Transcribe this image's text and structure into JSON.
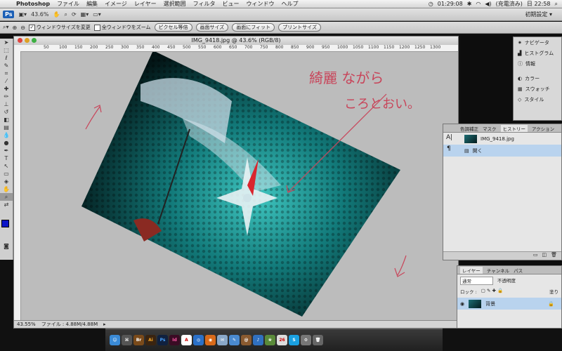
{
  "menubar": {
    "app_name": "Photoshop",
    "items": [
      "ファイル",
      "編集",
      "イメージ",
      "レイヤー",
      "選択範囲",
      "フィルタ",
      "ビュー",
      "ウィンドウ",
      "ヘルプ"
    ],
    "clock": "01:29:08",
    "battery": "(充電済み)",
    "date_time": "日 22:58"
  },
  "appbar": {
    "zoom": "43.6%",
    "workspace": "初期設定 ▾"
  },
  "options": {
    "resize_window": "ウィンドウサイズを変更",
    "zoom_all": "全ウィンドウをズーム",
    "buttons": [
      "ピクセル等倍",
      "画面サイズ",
      "画面にフィット",
      "プリントサイズ"
    ]
  },
  "document": {
    "title": "IMG_9418.jpg @ 43.6% (RGB/8)",
    "ruler_ticks": [
      "50",
      "100",
      "150",
      "200",
      "250",
      "300",
      "350",
      "400",
      "450",
      "500",
      "550",
      "600",
      "650",
      "700",
      "750",
      "800",
      "850",
      "900",
      "950",
      "1000",
      "1050",
      "1100",
      "1150",
      "1200",
      "1250",
      "1300"
    ],
    "zoom_status": "43.55%",
    "file_status": "ファイル : 4.88M/4.88M",
    "annotation_line1": "綺麗 ながら",
    "annotation_line2": "ころとおい。"
  },
  "nav_panel": {
    "items": [
      "ナビゲータ",
      "ヒストグラム",
      "情報",
      "カラー",
      "スウォッチ",
      "スタイル"
    ]
  },
  "history_panel": {
    "tabs": [
      "色調補正",
      "マスク",
      "ヒストリー",
      "アクション"
    ],
    "snapshot": "IMG_9418.jpg",
    "step": "開く"
  },
  "layers_panel": {
    "tabs": [
      "レイヤー",
      "チャンネル",
      "パス"
    ],
    "blend_mode": "通常",
    "opacity_label": "不透明度",
    "lock_label": "ロック :",
    "fill_label": "塗り",
    "layer_name": "背景"
  },
  "dock": {
    "labels": [
      "Br",
      "Ai",
      "Ps",
      "Id"
    ]
  },
  "colors": {
    "accent": "#1b5fb6",
    "annotation": "#c8455a"
  }
}
